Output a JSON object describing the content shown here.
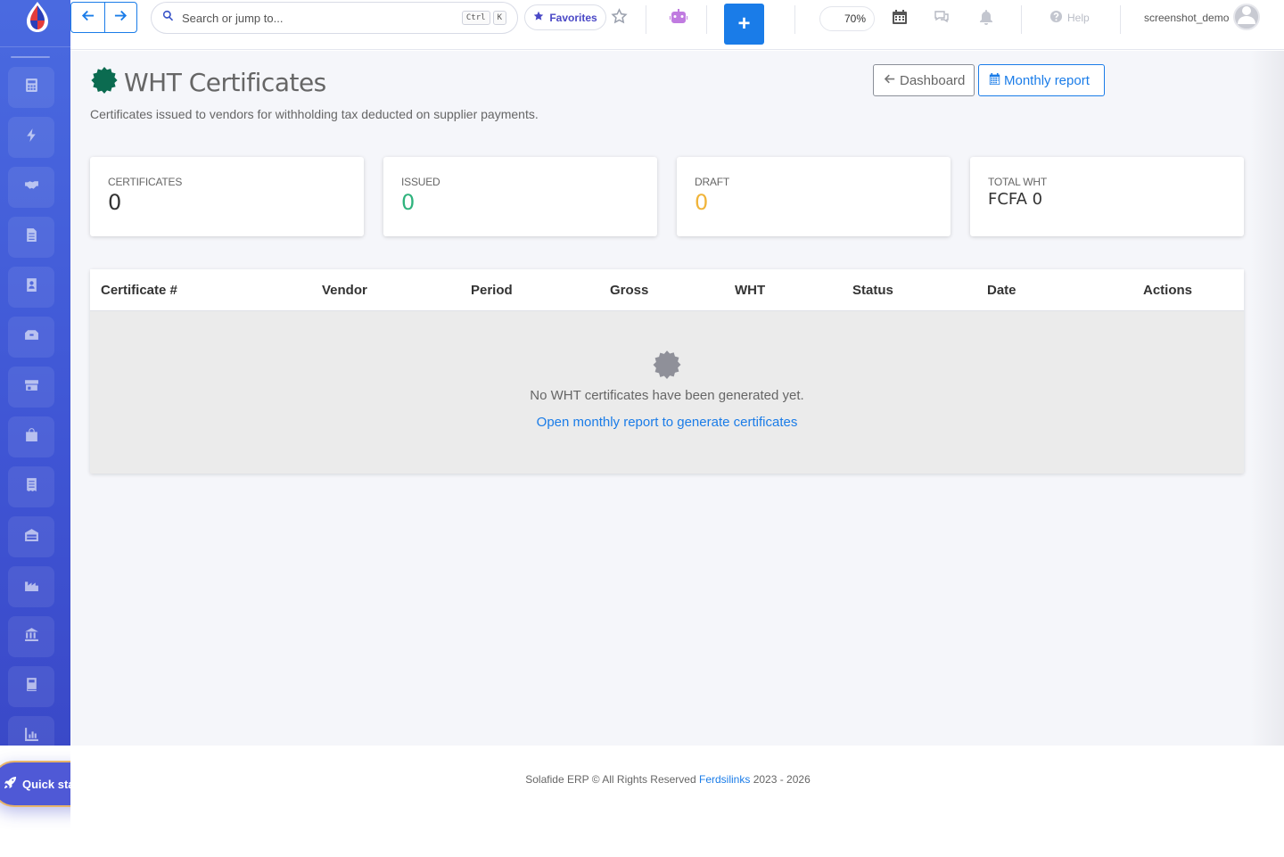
{
  "topbar": {
    "search_placeholder": "Search or jump to...",
    "search_kbd": [
      "Ctrl",
      "K"
    ],
    "favorites_label": "Favorites",
    "add_label": "+",
    "zoom_level": "70%",
    "help_label": "Help",
    "username": "screenshot_demo"
  },
  "page": {
    "title": "WHT Certificates",
    "subtitle": "Certificates issued to vendors for withholding tax deducted on supplier payments.",
    "dashboard_button": "Dashboard",
    "monthly_report_button": "Monthly report"
  },
  "cards": [
    {
      "label": "CERTIFICATES",
      "value": "0",
      "color": "#333333"
    },
    {
      "label": "ISSUED",
      "value": "0",
      "color": "#2fb37d"
    },
    {
      "label": "DRAFT",
      "value": "0",
      "color": "#f0b43a"
    },
    {
      "label": "TOTAL WHT",
      "value": "FCFA 0",
      "color": "#333333"
    }
  ],
  "table": {
    "columns": [
      "Certificate #",
      "Vendor",
      "Period",
      "Gross",
      "WHT",
      "Status",
      "Date",
      "Actions"
    ],
    "empty_message": "No WHT certificates have been generated yet.",
    "empty_link": "Open monthly report to generate certificates"
  },
  "sidebar": {
    "icons": [
      "calculator-icon",
      "bolt-icon",
      "handshake-icon",
      "document-icon",
      "contact-icon",
      "boxes-icon",
      "store-icon",
      "shopping-bag-icon",
      "receipt-icon",
      "warehouse-icon",
      "factory-icon",
      "bank-icon",
      "book-icon",
      "chart-icon"
    ],
    "quick_start_label": "Quick start"
  },
  "footer": {
    "prefix": "Solafide ERP © All Rights Reserved",
    "brand": "Ferdsilinks",
    "years": "2023 - 2026"
  },
  "colors": {
    "accent": "#1a7ce8",
    "sidebar": "#4058d6",
    "title_icon": "#0b6b50"
  }
}
